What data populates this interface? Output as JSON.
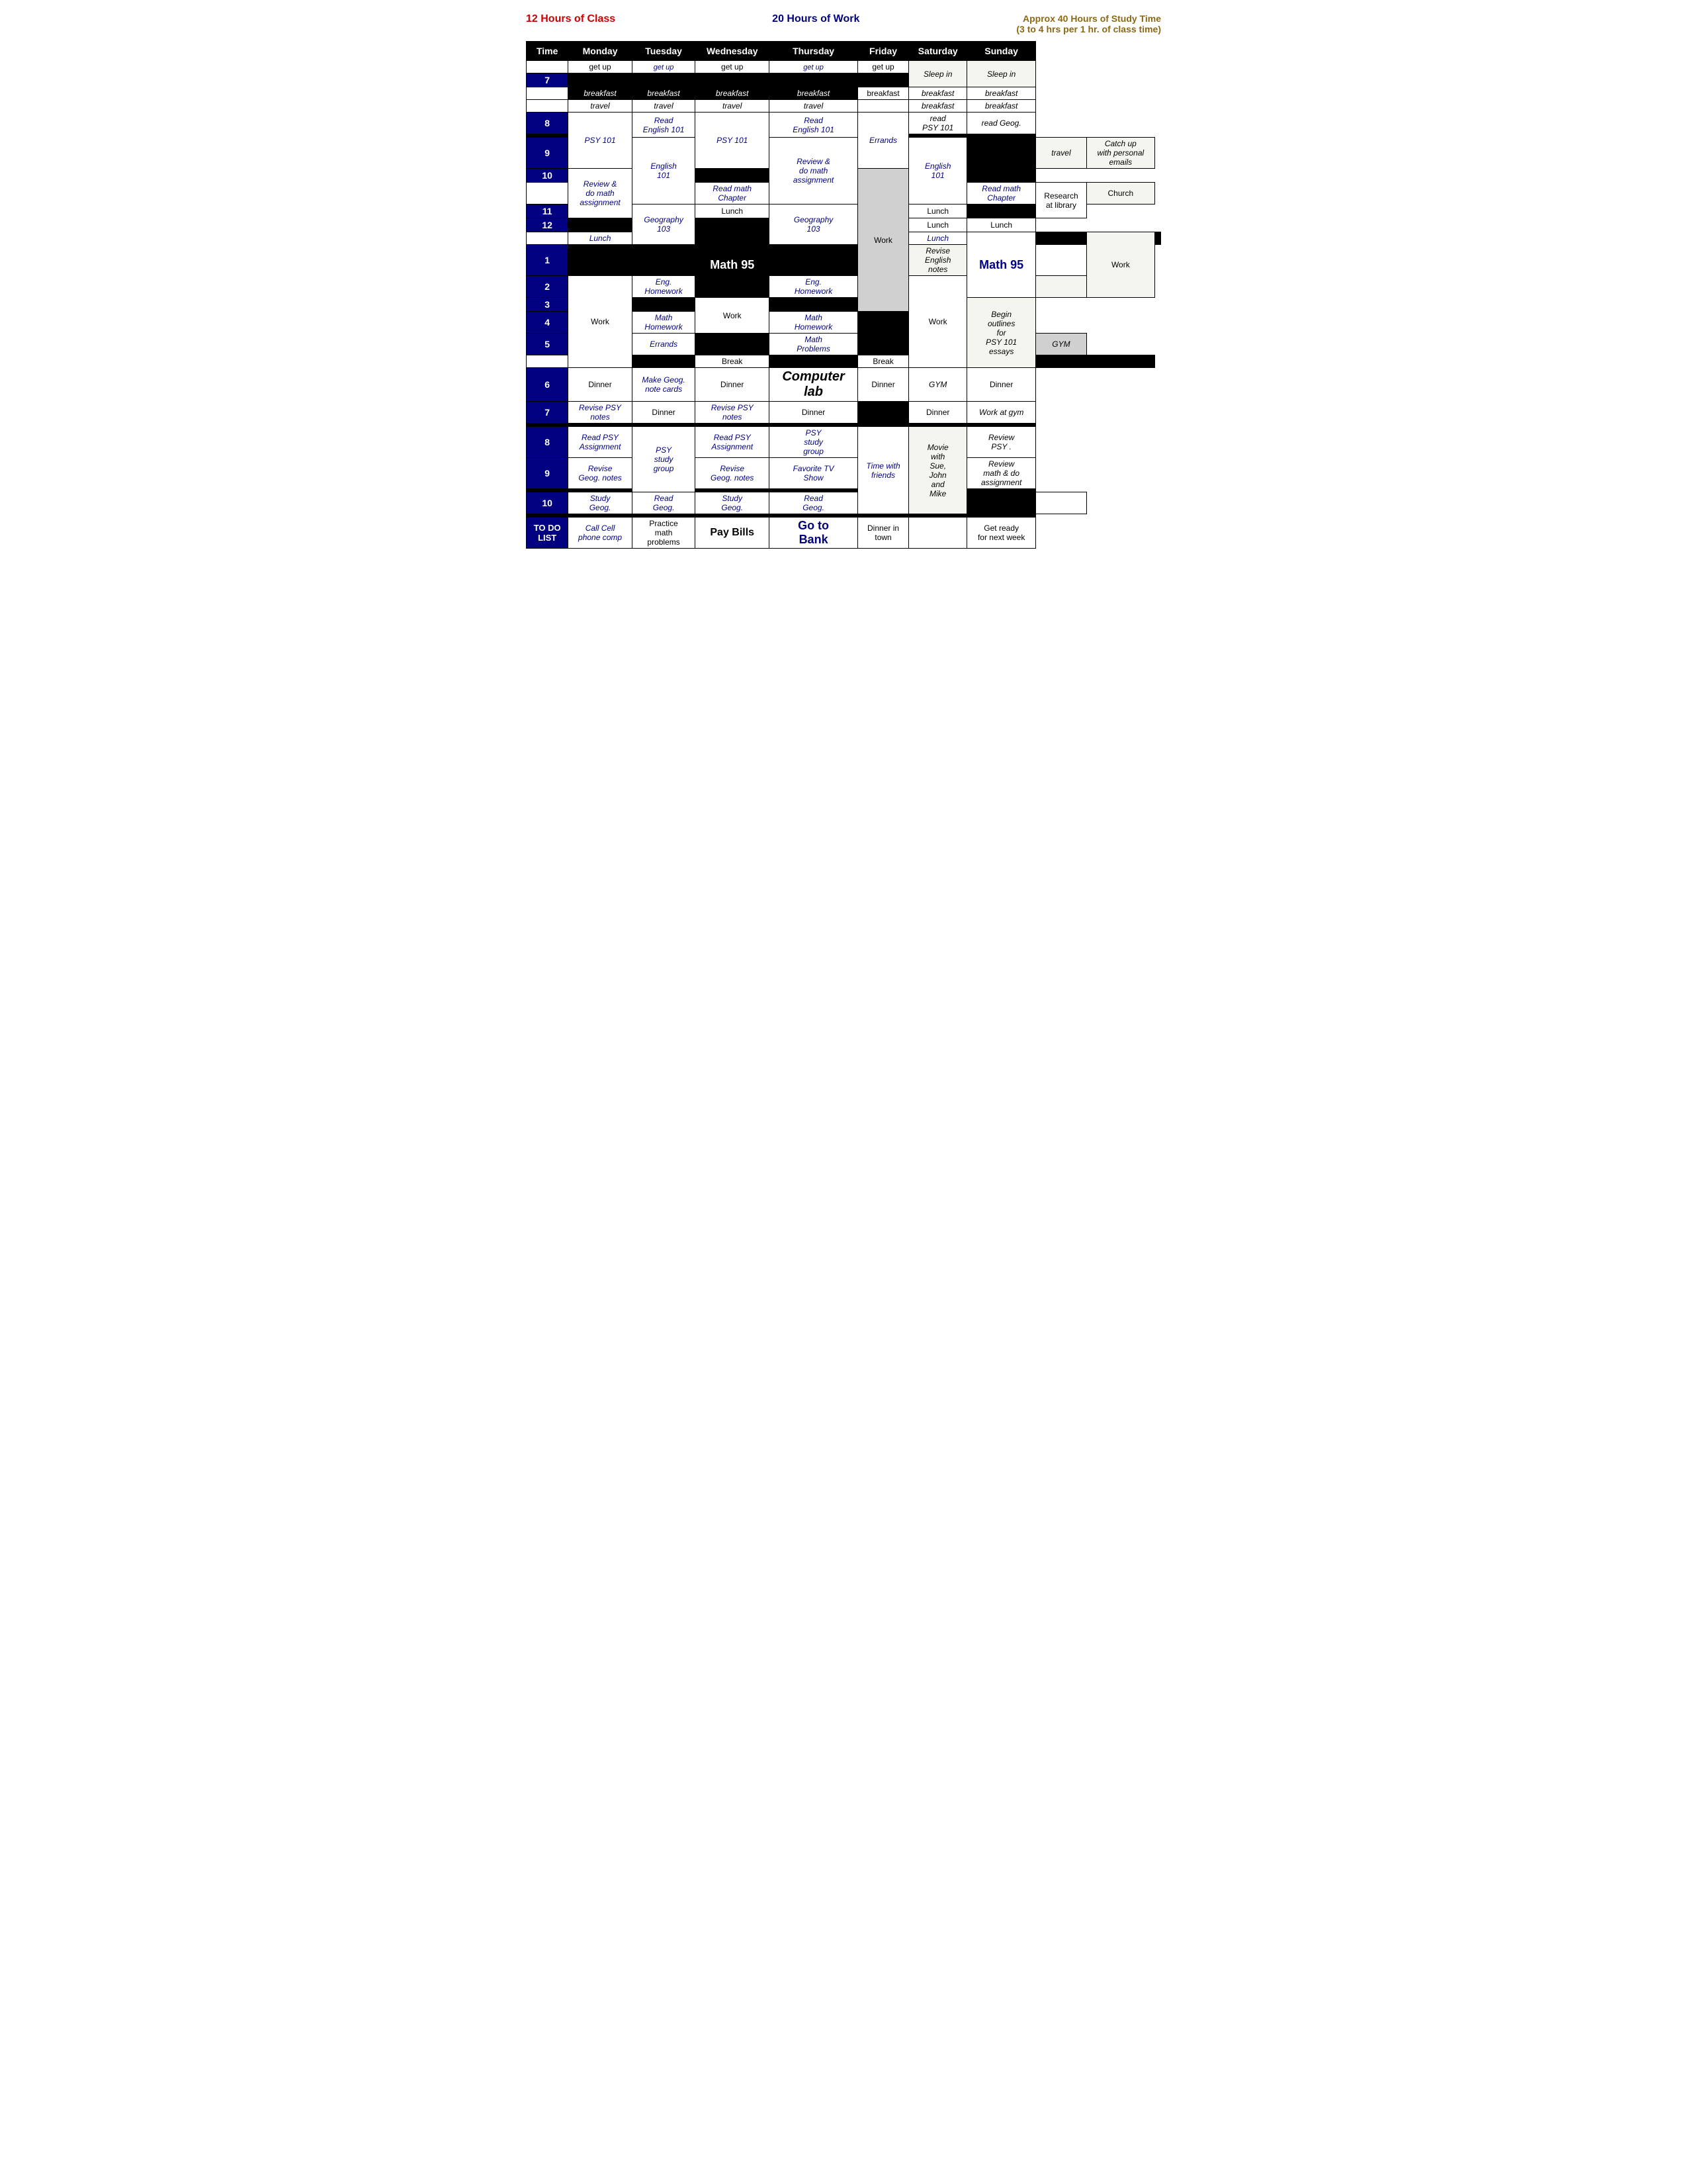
{
  "header": {
    "left": "12 Hours of Class",
    "center": "20 Hours of Work",
    "right": "Approx 40 Hours of Study Time\n(3 to 4 hrs per 1 hr. of class time)"
  },
  "columns": [
    "Time",
    "Monday",
    "Tuesday",
    "Wednesday",
    "Thursday",
    "Friday",
    "Saturday",
    "Sunday"
  ]
}
